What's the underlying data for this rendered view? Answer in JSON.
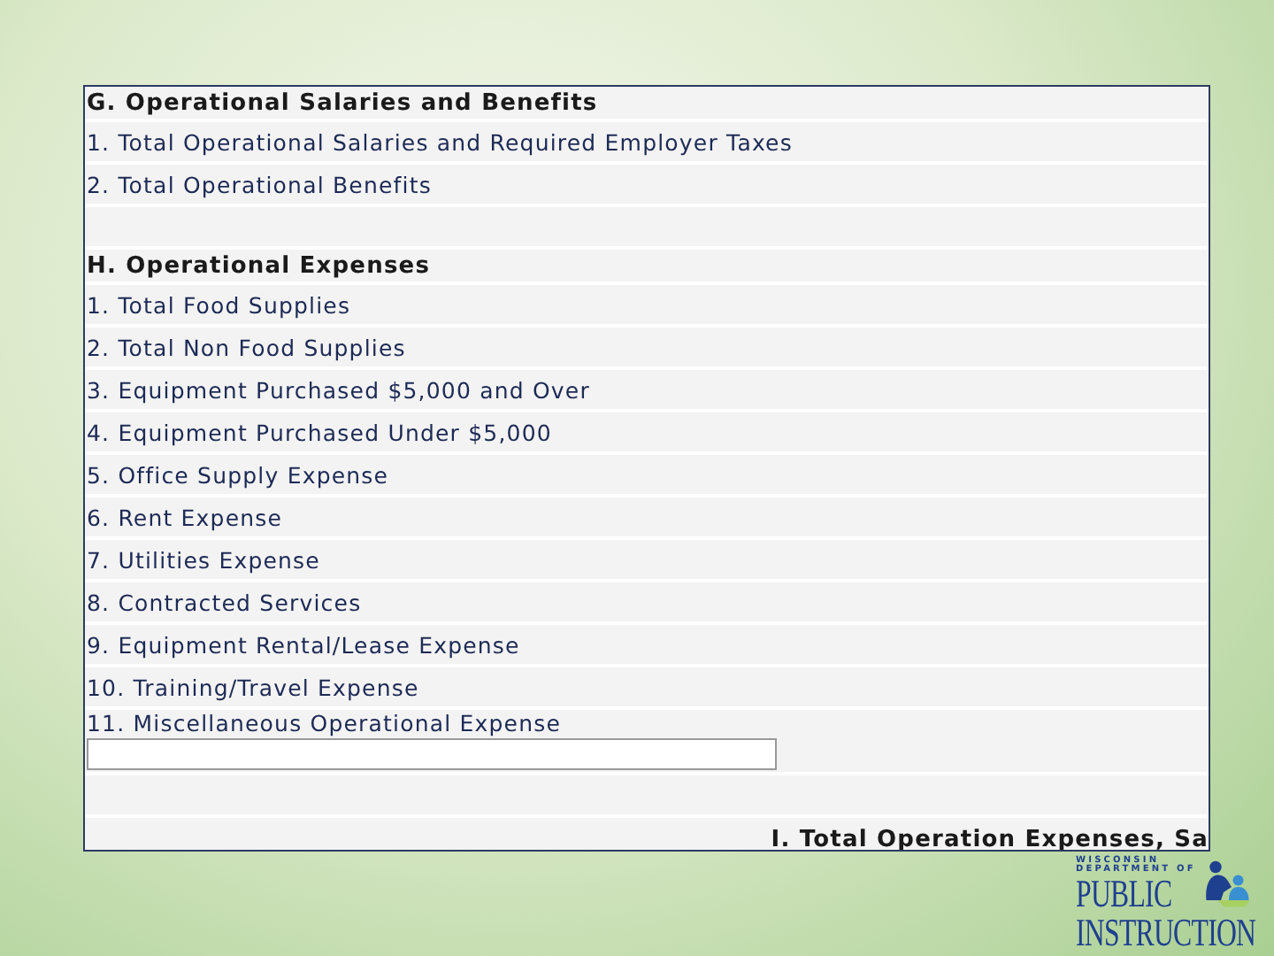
{
  "form": {
    "rows": [
      {
        "kind": "heading",
        "text": "G. Operational Salaries and Benefits"
      },
      {
        "kind": "item",
        "text": "1. Total Operational Salaries and Required Employer Taxes"
      },
      {
        "kind": "item",
        "text": "2. Total Operational Benefits"
      },
      {
        "kind": "spacer"
      },
      {
        "kind": "heading",
        "text": "H. Operational Expenses"
      },
      {
        "kind": "item",
        "text": "1. Total Food Supplies"
      },
      {
        "kind": "item",
        "text": "2. Total Non Food Supplies"
      },
      {
        "kind": "item",
        "text": "3. Equipment Purchased $5,000 and Over"
      },
      {
        "kind": "item",
        "text": "4. Equipment Purchased Under $5,000"
      },
      {
        "kind": "item",
        "text": "5. Office Supply Expense"
      },
      {
        "kind": "item",
        "text": "6. Rent Expense"
      },
      {
        "kind": "item",
        "text": "7. Utilities Expense"
      },
      {
        "kind": "item",
        "text": "8. Contracted Services"
      },
      {
        "kind": "item",
        "text": "9. Equipment Rental/Lease Expense"
      },
      {
        "kind": "item",
        "text": "10. Training/Travel Expense"
      },
      {
        "kind": "short",
        "text": "11. Miscellaneous Operational Expense"
      },
      {
        "kind": "input"
      },
      {
        "kind": "spacer"
      },
      {
        "kind": "total",
        "text": "I. Total Operation Expenses, Sa"
      }
    ]
  },
  "logo": {
    "line_1": "WISCONSIN",
    "line_2": "DEPARTMENT OF",
    "line_3": "PUBLIC",
    "line_4": "INSTRUCTION"
  }
}
